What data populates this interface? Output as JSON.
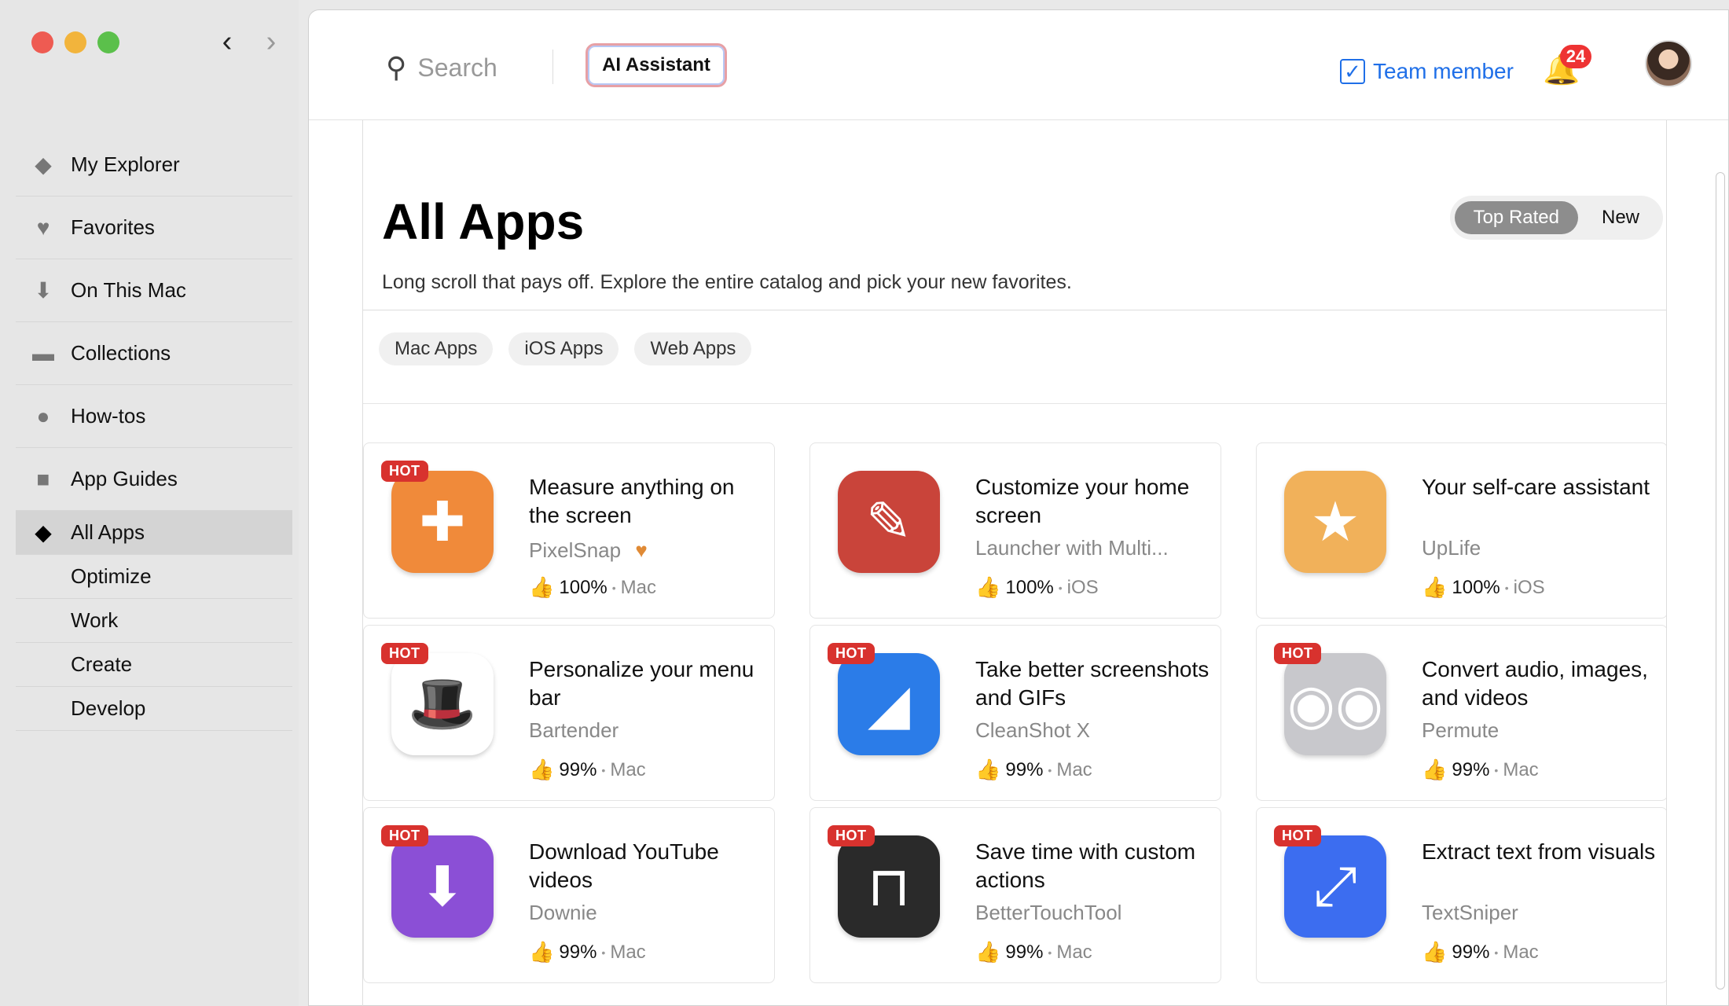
{
  "sidebar": {
    "items": [
      {
        "label": "My Explorer",
        "icon": "explorer-icon"
      },
      {
        "label": "Favorites",
        "icon": "heart-icon"
      },
      {
        "label": "On This Mac",
        "icon": "download-icon"
      },
      {
        "label": "Collections",
        "icon": "folder-icon"
      },
      {
        "label": "How-tos",
        "icon": "lightbulb-icon"
      },
      {
        "label": "App Guides",
        "icon": "book-icon"
      },
      {
        "label": "All Apps",
        "icon": "diamond-icon"
      },
      {
        "label": "Optimize",
        "icon": ""
      },
      {
        "label": "Work",
        "icon": ""
      },
      {
        "label": "Create",
        "icon": ""
      },
      {
        "label": "Develop",
        "icon": ""
      }
    ],
    "active": "All Apps"
  },
  "topbar": {
    "search_placeholder": "Search",
    "ai_button": "AI Assistant",
    "team_member": "Team member",
    "notifications_count": "24"
  },
  "page": {
    "title": "All Apps",
    "subtitle": "Long scroll that pays off. Explore the entire catalog and pick your new favorites.",
    "sort": {
      "top_rated": "Top Rated",
      "new": "New"
    },
    "filters": [
      "Mac Apps",
      "iOS Apps",
      "Web Apps"
    ]
  },
  "apps": [
    {
      "hot": "HOT",
      "title": "Measure anything on the screen",
      "name": "PixelSnap",
      "rating": "100%",
      "platform": "Mac",
      "favorite": true,
      "color": "#f08a3a",
      "glyph": "✚"
    },
    {
      "hot": "",
      "title": "Customize your home screen",
      "name": "Launcher with Multi...",
      "rating": "100%",
      "platform": "iOS",
      "favorite": false,
      "color": "#c9443a",
      "glyph": "✎"
    },
    {
      "hot": "",
      "title": "Your self-care assistant",
      "name": "UpLife",
      "rating": "100%",
      "platform": "iOS",
      "favorite": false,
      "color": "#f1b15a",
      "glyph": "★"
    },
    {
      "hot": "HOT",
      "title": "Personalize your menu bar",
      "name": "Bartender",
      "rating": "99%",
      "platform": "Mac",
      "favorite": false,
      "color": "#ffffff",
      "glyph": "🎩"
    },
    {
      "hot": "HOT",
      "title": "Take better screenshots and GIFs",
      "name": "CleanShot X",
      "rating": "99%",
      "platform": "Mac",
      "favorite": false,
      "color": "#2b7ce8",
      "glyph": "◢"
    },
    {
      "hot": "HOT",
      "title": "Convert audio, images, and videos",
      "name": "Permute",
      "rating": "99%",
      "platform": "Mac",
      "favorite": false,
      "color": "#c8c8cc",
      "glyph": "◉◉"
    },
    {
      "hot": "HOT",
      "title": "Download YouTube videos",
      "name": "Downie",
      "rating": "99%",
      "platform": "Mac",
      "favorite": false,
      "color": "#8b4fd6",
      "glyph": "⬇"
    },
    {
      "hot": "HOT",
      "title": "Save time with custom actions",
      "name": "BetterTouchTool",
      "rating": "99%",
      "platform": "Mac",
      "favorite": false,
      "color": "#2a2a2a",
      "glyph": "⊓"
    },
    {
      "hot": "HOT",
      "title": "Extract text from visuals",
      "name": "TextSniper",
      "rating": "99%",
      "platform": "Mac",
      "favorite": false,
      "color": "#3c6df0",
      "glyph": "⤢"
    }
  ]
}
